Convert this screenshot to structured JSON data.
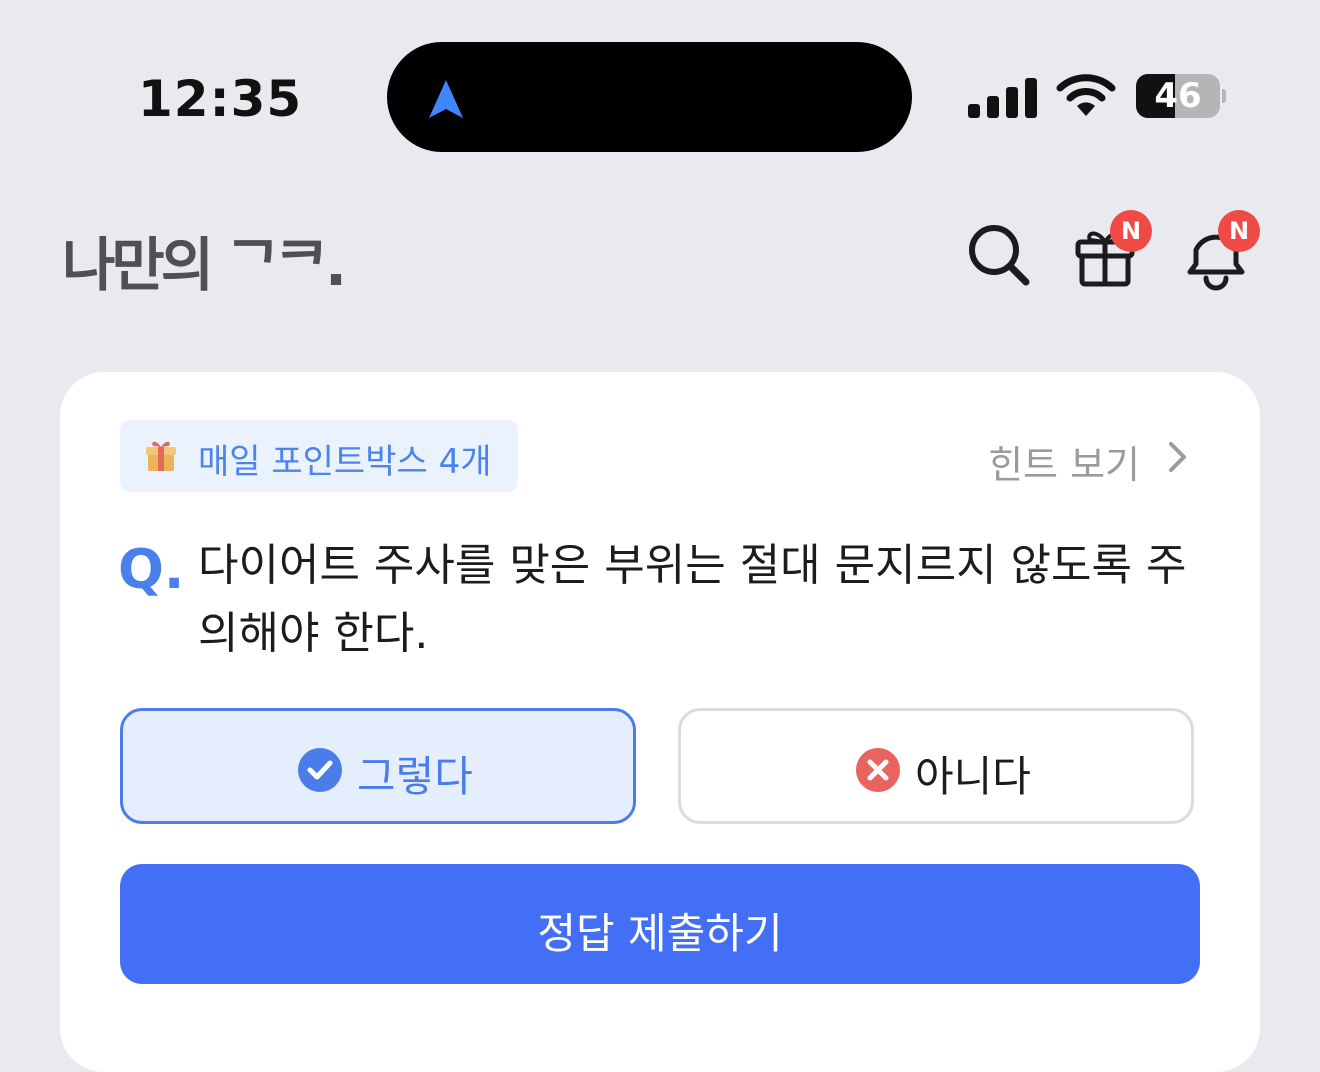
{
  "status_bar": {
    "time": "12:35",
    "battery": {
      "text": "46",
      "level": 0.46
    }
  },
  "header": {
    "logo": "나만의 ᄀᄏ.",
    "gift_badge": "N",
    "bell_badge": "N"
  },
  "quiz": {
    "pointbox_label": "매일 포인트박스 4개",
    "hint_label": "힌트 보기",
    "q_mark": "Q.",
    "question": "다이어트 주사를 맞은 부위는 절대 문지르지 않도록 주의해야 한다.",
    "options": [
      {
        "label": "그렇다",
        "selected": true
      },
      {
        "label": "아니다",
        "selected": false
      }
    ],
    "submit_label": "정답 제출하기"
  },
  "colors": {
    "accent": "#436ff6",
    "badge": "#ef4a45",
    "selected_border": "#4a7de9",
    "wrong_icon": "#e9645f"
  }
}
